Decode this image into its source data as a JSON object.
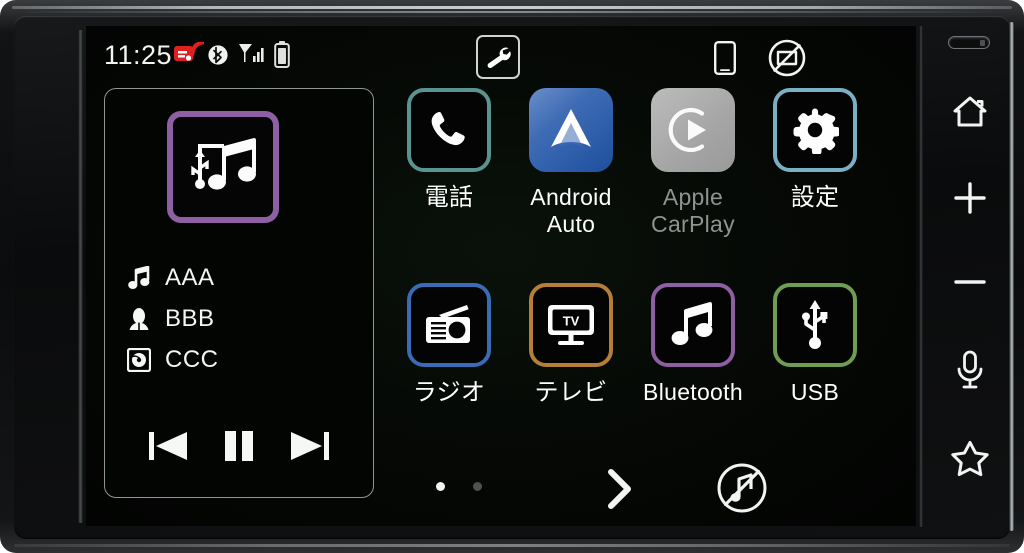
{
  "device": {
    "name": "car-audio-head-unit"
  },
  "statusbar": {
    "clock": "11:25",
    "icons": [
      {
        "name": "etc-dsrc-icon",
        "color": "#e02020"
      },
      {
        "name": "bluetooth-icon"
      },
      {
        "name": "signal-strength-icon"
      },
      {
        "name": "battery-icon"
      }
    ],
    "tool_button": "wrench-icon",
    "phone_indicator": "smartphone-icon",
    "no_display_indicator": "display-off-icon"
  },
  "nowplaying": {
    "album_art_icon": "usb-music-icon",
    "album_art_border_color": "#8f5fa4",
    "meta": [
      {
        "icon": "music-note-icon",
        "text": "AAA"
      },
      {
        "icon": "artist-icon",
        "text": "BBB"
      },
      {
        "icon": "album-disc-icon",
        "text": "CCC"
      }
    ],
    "controls": [
      {
        "name": "previous-track-button",
        "icon": "skip-previous-icon"
      },
      {
        "name": "pause-button",
        "icon": "pause-icon"
      },
      {
        "name": "next-track-button",
        "icon": "skip-next-icon"
      }
    ]
  },
  "appgrid": {
    "apps": [
      {
        "id": "phone",
        "label": "電話",
        "icon": "phone-icon",
        "style": "bordered",
        "border": "#5a9490",
        "enabled": true
      },
      {
        "id": "android-auto",
        "label": "Android\nAuto",
        "icon": "android-auto-icon",
        "style": "filled",
        "border": "#2a5fae",
        "enabled": true
      },
      {
        "id": "apple-carplay",
        "label": "Apple\nCarPlay",
        "icon": "apple-carplay-icon",
        "style": "filled",
        "border": "#a8a8a8",
        "enabled": false
      },
      {
        "id": "settings",
        "label": "設定",
        "icon": "gear-icon",
        "style": "bordered",
        "border": "#7ab0c4",
        "enabled": true
      },
      {
        "id": "radio",
        "label": "ラジオ",
        "icon": "radio-icon",
        "style": "bordered",
        "border": "#3a6bb5",
        "enabled": true
      },
      {
        "id": "tv",
        "label": "テレビ",
        "icon": "tv-icon",
        "style": "bordered",
        "border": "#b57f3a",
        "enabled": true
      },
      {
        "id": "bluetooth",
        "label": "Bluetooth",
        "icon": "music-note-icon",
        "style": "bordered",
        "border": "#8f5fa4",
        "enabled": true
      },
      {
        "id": "usb",
        "label": "USB",
        "icon": "usb-icon",
        "style": "bordered",
        "border": "#6f9e52",
        "enabled": true
      }
    ]
  },
  "bottombar": {
    "pages": {
      "count": 2,
      "current": 1
    },
    "next_page_icon": "chevron-right-icon",
    "mute_icon": "mute-music-icon"
  },
  "hardware_keys": [
    {
      "name": "status-led",
      "icon": "led-indicator"
    },
    {
      "name": "home-button",
      "icon": "home-icon"
    },
    {
      "name": "volume-up-button",
      "icon": "plus-icon"
    },
    {
      "name": "volume-down-button",
      "icon": "minus-icon"
    },
    {
      "name": "voice-command-button",
      "icon": "microphone-icon"
    },
    {
      "name": "favorite-button",
      "icon": "star-icon"
    }
  ]
}
